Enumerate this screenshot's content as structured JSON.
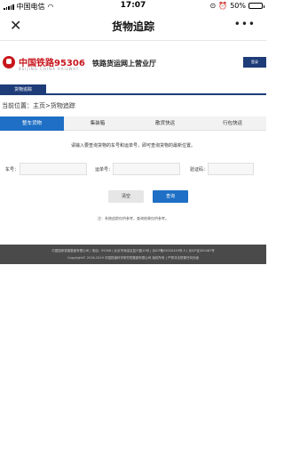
{
  "status_bar": {
    "carrier": "中国电信",
    "time": "17:07",
    "battery": "50%",
    "battery_level": 0.5
  },
  "nav_bar": {
    "title": "货物追踪"
  },
  "brand": {
    "name": "中国铁路95306",
    "subtitle": "BEIJING CHINA RAILWAY",
    "hall": "铁路货运网上营业厅",
    "login": "登录"
  },
  "main_nav": {
    "active_tab": "货物追踪"
  },
  "breadcrumb": {
    "text": "当前位置：主页>货物追踪"
  },
  "tabs": [
    "整车货物",
    "集装箱",
    "散货快运",
    "行包快运"
  ],
  "hint": "请输入要查询货物的车号和运单号，即可查询货物的最新位置。",
  "form": {
    "car_label": "车号：",
    "waybill_label": "运单号：",
    "captcha_label": "验证码："
  },
  "buttons": {
    "clear": "清空",
    "search": "查询"
  },
  "note": "注：系统追踪仅供参考，查询结果仅供参考。",
  "footer": {
    "line1": "中国国家铁路集团有限公司  |  电话：95306  |  北京市海淀区复兴路10号  |  京ICP备05020493号-5  |  京ICP证050487号",
    "line2": "Copyright© 2016-2019 中国铁道科学研究院集团有限公司 版权所有 | 严禁非法镜像任何页面"
  }
}
